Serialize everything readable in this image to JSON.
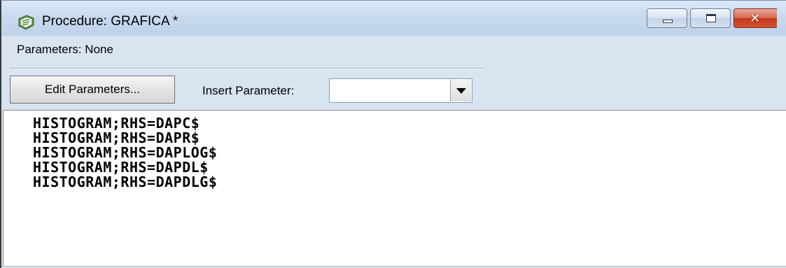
{
  "window": {
    "title": "Procedure: GRAFICA *",
    "icon": "procedure-document-icon",
    "caption_buttons": {
      "minimize_icon": "minimize-icon",
      "maximize_icon": "maximize-icon",
      "close_icon": "close-icon",
      "close_glyph": "✕"
    }
  },
  "parameters": {
    "label": "Parameters: None"
  },
  "toolbar": {
    "edit_parameters_label": "Edit Parameters...",
    "insert_parameter_label": "Insert Parameter:",
    "insert_parameter_value": ""
  },
  "editor": {
    "lines": [
      "HISTOGRAM;RHS=DAPC$",
      "HISTOGRAM;RHS=DAPR$",
      "HISTOGRAM;RHS=DAPLOG$",
      "HISTOGRAM;RHS=DAPDL$",
      "HISTOGRAM;RHS=DAPDLG$"
    ]
  },
  "colors": {
    "chrome_background": "#d9e4f1",
    "close_button": "#c4361a",
    "editor_background": "#ffffff"
  }
}
